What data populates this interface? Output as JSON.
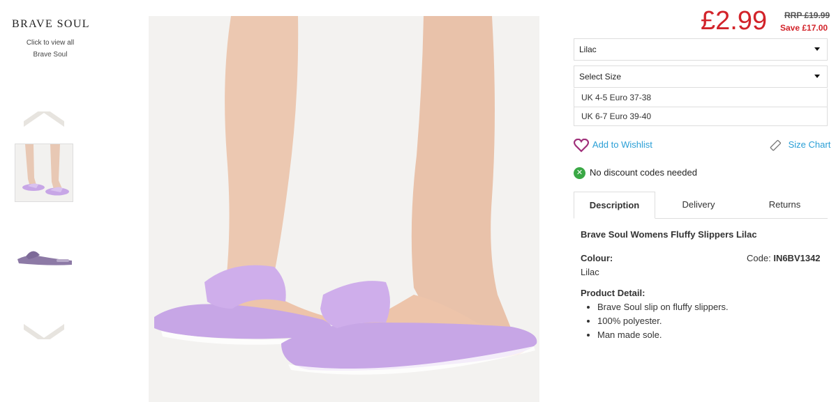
{
  "brand": {
    "logo": "BRAVE SOUL",
    "link_line1": "Click to view all",
    "link_line2": "Brave Soul"
  },
  "gallery": {
    "up_icon": "chevron-up-icon",
    "down_icon": "chevron-down-icon",
    "thumbnails": [
      "model-feet-slippers",
      "slipper-side-view"
    ]
  },
  "pricing": {
    "price": "£2.99",
    "rrp": "RRP £19.99",
    "save": "Save £17.00"
  },
  "options": {
    "colour_selected": "Lilac",
    "size_placeholder": "Select Size",
    "sizes": [
      "UK 4-5 Euro 37-38",
      "UK 6-7 Euro 39-40"
    ]
  },
  "actions": {
    "wishlist": "Add to Wishlist",
    "size_chart": "Size Chart",
    "no_discount": "No discount codes needed"
  },
  "tabs": [
    "Description",
    "Delivery",
    "Returns"
  ],
  "description": {
    "title": "Brave Soul Womens Fluffy Slippers Lilac",
    "colour_label": "Colour:",
    "colour_value": "Lilac",
    "code_label": "Code:",
    "code_value": "IN6BV1342",
    "detail_label": "Product Detail:",
    "details": [
      "Brave Soul slip on fluffy slippers.",
      "100% polyester.",
      "Man made sole."
    ]
  },
  "colors": {
    "price_red": "#d2232a",
    "link_blue": "#2a9fd6",
    "slipper_lilac": "#c7a6e6"
  }
}
